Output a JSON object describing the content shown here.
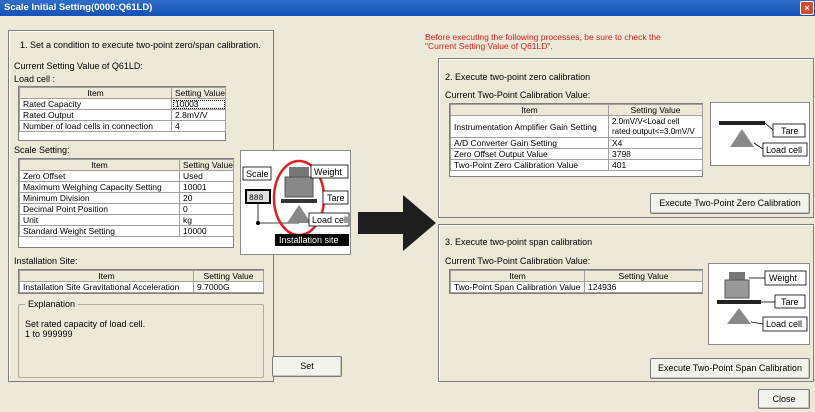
{
  "window": {
    "title": "Scale Initial Setting(0000:Q61LD)",
    "close_glyph": "×"
  },
  "left": {
    "step1": "1.  Set a condition to execute two-point zero/span calibration.",
    "current_label": "Current Setting Value of Q61LD:",
    "load_cell_label": "Load cell :",
    "load_cell_table": {
      "headers": [
        "Item",
        "Setting Value"
      ],
      "rows": [
        [
          "Rated Capacity",
          "10003"
        ],
        [
          "Rated Output",
          "2.8mV/V"
        ],
        [
          "Number of load cells in connection",
          "4"
        ]
      ]
    },
    "scale_setting_label": "Scale Setting:",
    "scale_table": {
      "headers": [
        "Item",
        "Setting Value"
      ],
      "rows": [
        [
          "Zero Offset",
          "Used"
        ],
        [
          "Maximum Weighing Capacity Setting",
          "10001"
        ],
        [
          "Minimum Division",
          "20"
        ],
        [
          "Decimal Point Position",
          "0"
        ],
        [
          "Unit",
          "kg"
        ],
        [
          "Standard Weight Setting",
          "10000"
        ]
      ]
    },
    "installation_label": "Installation Site:",
    "installation_table": {
      "headers": [
        "Item",
        "Setting Value"
      ],
      "rows": [
        [
          "Installation Site Gravitational Acceleration",
          "9.7000G"
        ]
      ]
    },
    "explanation_legend": "Explanation",
    "explanation_text_1": "Set rated capacity of load cell.",
    "explanation_text_2": "1 to 999999",
    "set_button": "Set",
    "diagram": {
      "scale": "Scale",
      "display": "888",
      "weight": "Weight",
      "tare": "Tare",
      "load_cell": "Load cell",
      "site": "Installation site"
    }
  },
  "right": {
    "warning_1": "Before executing the following processes, be sure to check the",
    "warning_2": "\"Current Setting Value of Q61LD\".",
    "zero": {
      "title": "2.  Execute two-point zero calibration",
      "current_label": "Current Two-Point Calibration Value:",
      "headers": [
        "Item",
        "Setting Value"
      ],
      "rows": [
        [
          "Instrumentation Amplifier Gain Setting",
          "2.0mV/V<Load cell rated output<=3.0mV/V"
        ],
        [
          "A/D Converter Gain Setting",
          "X4"
        ],
        [
          "Zero Offset Output Value",
          "3798"
        ],
        [
          "Two-Point Zero Calibration Value",
          "401"
        ]
      ],
      "button": "Execute Two-Point Zero Calibration",
      "diagram": {
        "tare": "Tare",
        "load_cell": "Load cell"
      }
    },
    "span": {
      "title": "3.  Execute two-point span calibration",
      "current_label": "Current Two-Point Calibration Value:",
      "headers": [
        "Item",
        "Setting Value"
      ],
      "rows": [
        [
          "Two-Point Span Calibration Value",
          "124936"
        ]
      ],
      "button": "Execute Two-Point Span Calibration",
      "diagram": {
        "weight": "Weight",
        "tare": "Tare",
        "load_cell": "Load cell"
      }
    },
    "close_button": "Close"
  },
  "colors": {
    "title_bar": "#1450b8",
    "warning_text": "#d81e1e",
    "highlight_ring": "#e02020"
  }
}
